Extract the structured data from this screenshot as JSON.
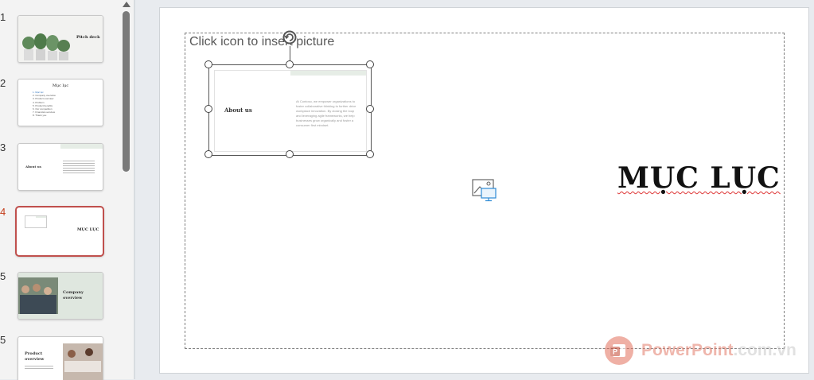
{
  "thumbnails": [
    {
      "number": "1",
      "title": "Pitch deck",
      "active": false
    },
    {
      "number": "2",
      "title": "Mục lục",
      "items": [
        "1. Mục lục",
        "2. Company overview",
        "3. Product overview",
        "4. Problem",
        "5. Product benefits",
        "6. Our competition",
        "7. Financial overview",
        "8. Thank you"
      ],
      "active": false
    },
    {
      "number": "3",
      "title": "About us",
      "active": false
    },
    {
      "number": "4",
      "title": "MỤC LỤC",
      "active": true
    },
    {
      "number": "5",
      "title": "Company overview",
      "active": false
    },
    {
      "number": "5",
      "title": "Product overview",
      "active": false
    }
  ],
  "slide": {
    "placeholder_hint": "Click icon to insert picture",
    "embedded_title": "About us",
    "embedded_body": "At Contoso, we empower organizations to foster collaborative thinking to further drive workplace innovation. By closing the loop and leveraging agile frameworks, we help businesses grow organically and foster a consumer first mindset.",
    "heading": "MỤC LỤC"
  },
  "watermark": {
    "brand": "PowerPoint",
    "domain": ".com.vn"
  },
  "colors": {
    "active_border": "#c0504d",
    "spell_underline": "#dd3333",
    "icon_blue": "#2e8bd6"
  }
}
